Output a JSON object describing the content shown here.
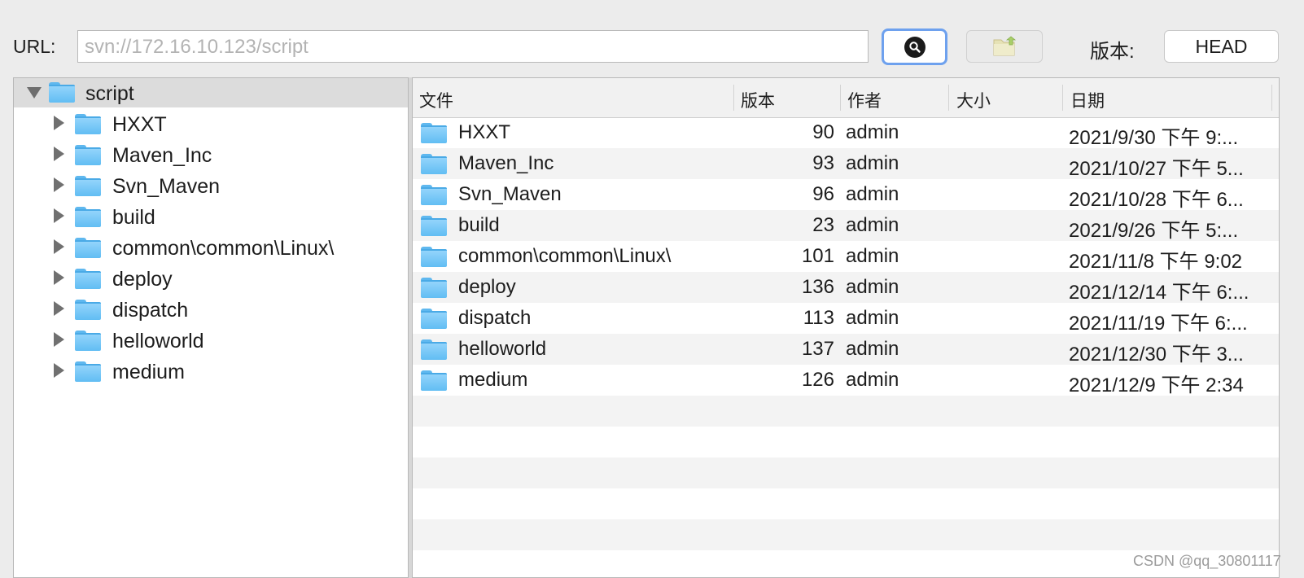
{
  "toolbar": {
    "url_label": "URL:",
    "url_placeholder": "svn://172.16.10.123/script",
    "revision_label": "版本:",
    "revision_button": "HEAD"
  },
  "tree": {
    "root": "script",
    "items": [
      {
        "label": "HXXT"
      },
      {
        "label": "Maven_Inc"
      },
      {
        "label": "Svn_Maven"
      },
      {
        "label": "build"
      },
      {
        "label": "common\\common\\Linux\\"
      },
      {
        "label": "deploy"
      },
      {
        "label": "dispatch"
      },
      {
        "label": "helloworld"
      },
      {
        "label": "medium"
      }
    ]
  },
  "table": {
    "columns": [
      "文件",
      "版本",
      "作者",
      "大小",
      "日期"
    ],
    "rows": [
      {
        "name": "HXXT",
        "rev": "90",
        "author": "admin",
        "size": "",
        "date": "2021/9/30 下午 9:..."
      },
      {
        "name": "Maven_Inc",
        "rev": "93",
        "author": "admin",
        "size": "",
        "date": "2021/10/27 下午 5..."
      },
      {
        "name": "Svn_Maven",
        "rev": "96",
        "author": "admin",
        "size": "",
        "date": "2021/10/28 下午 6..."
      },
      {
        "name": "build",
        "rev": "23",
        "author": "admin",
        "size": "",
        "date": "2021/9/26 下午 5:..."
      },
      {
        "name": "common\\common\\Linux\\",
        "rev": "101",
        "author": "admin",
        "size": "",
        "date": "2021/11/8 下午 9:02"
      },
      {
        "name": "deploy",
        "rev": "136",
        "author": "admin",
        "size": "",
        "date": "2021/12/14 下午 6:..."
      },
      {
        "name": "dispatch",
        "rev": "113",
        "author": "admin",
        "size": "",
        "date": "2021/11/19 下午 6:..."
      },
      {
        "name": "helloworld",
        "rev": "137",
        "author": "admin",
        "size": "",
        "date": "2021/12/30 下午 3..."
      },
      {
        "name": "medium",
        "rev": "126",
        "author": "admin",
        "size": "",
        "date": "2021/12/9 下午 2:34"
      }
    ]
  },
  "watermark": "CSDN @qq_30801117",
  "colors": {
    "folder": "#6cc3f5",
    "search_button_border": "#6ea1ee",
    "row_alt": "#f3f3f3",
    "tree_selected": "#dcdcdc"
  }
}
